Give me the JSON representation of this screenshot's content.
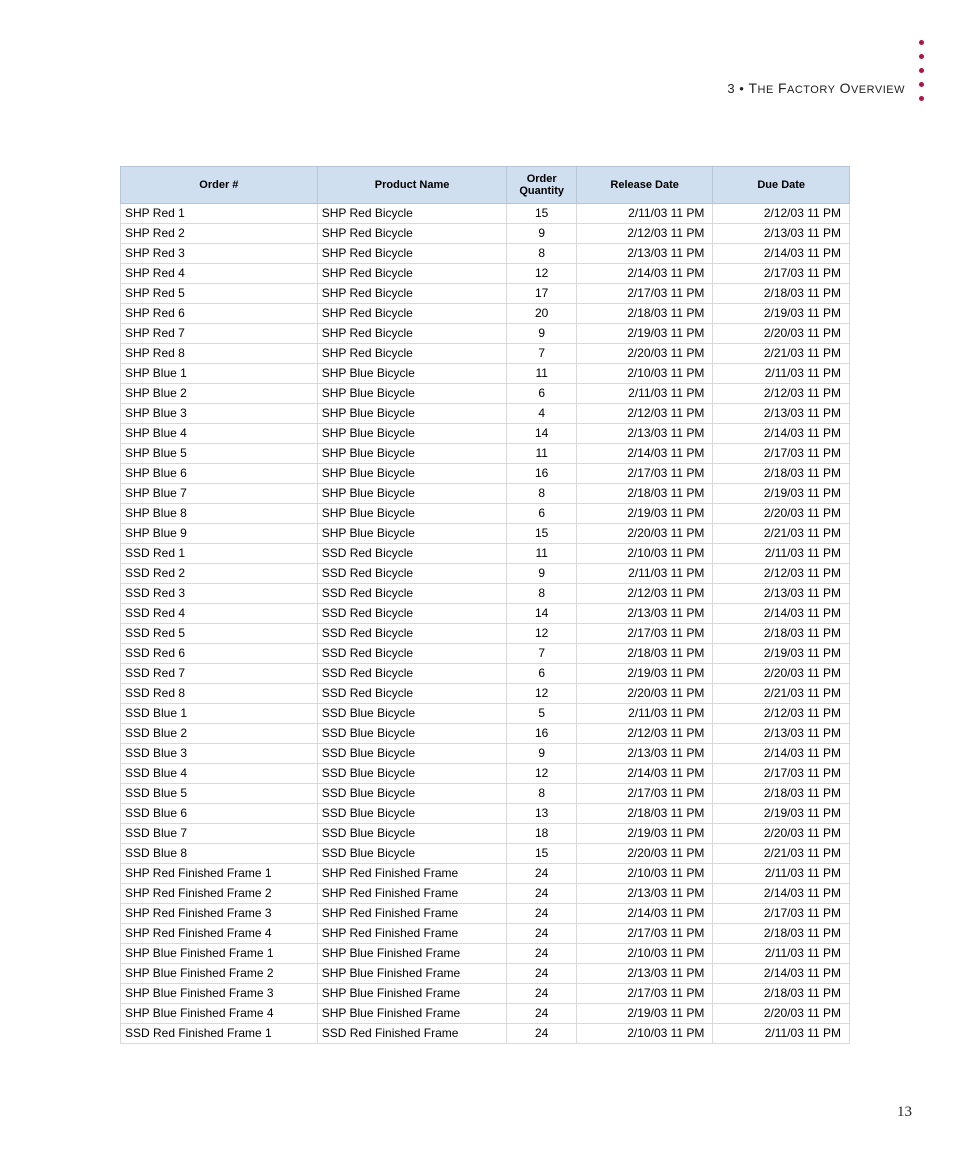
{
  "header": {
    "chapter_num": "3",
    "separator": "•",
    "title_smallcap_prefix": "T",
    "title_rest1": "HE",
    "title_word2_prefix": "F",
    "title_rest2": "ACTORY",
    "title_word3_prefix": "O",
    "title_rest3": "VERVIEW"
  },
  "page_number": "13",
  "table": {
    "columns": [
      "Order #",
      "Product Name",
      "Order Quantity",
      "Release Date",
      "Due Date"
    ],
    "ampm": "PM",
    "rows": [
      {
        "order": "SHP Red 1",
        "product": "SHP Red Bicycle",
        "qty": "15",
        "rel": "2/11/03 11",
        "due": "2/12/03 11"
      },
      {
        "order": "SHP Red 2",
        "product": "SHP Red Bicycle",
        "qty": "9",
        "rel": "2/12/03 11",
        "due": "2/13/03 11"
      },
      {
        "order": "SHP Red 3",
        "product": "SHP Red Bicycle",
        "qty": "8",
        "rel": "2/13/03 11",
        "due": "2/14/03 11"
      },
      {
        "order": "SHP Red 4",
        "product": "SHP Red Bicycle",
        "qty": "12",
        "rel": "2/14/03 11",
        "due": "2/17/03 11"
      },
      {
        "order": "SHP Red 5",
        "product": "SHP Red Bicycle",
        "qty": "17",
        "rel": "2/17/03 11",
        "due": "2/18/03 11"
      },
      {
        "order": "SHP Red 6",
        "product": "SHP Red Bicycle",
        "qty": "20",
        "rel": "2/18/03 11",
        "due": "2/19/03 11"
      },
      {
        "order": "SHP Red 7",
        "product": "SHP Red Bicycle",
        "qty": "9",
        "rel": "2/19/03 11",
        "due": "2/20/03 11"
      },
      {
        "order": "SHP Red 8",
        "product": "SHP Red Bicycle",
        "qty": "7",
        "rel": "2/20/03 11",
        "due": "2/21/03 11"
      },
      {
        "order": "SHP Blue 1",
        "product": "SHP Blue Bicycle",
        "qty": "11",
        "rel": "2/10/03 11",
        "due": "2/11/03 11"
      },
      {
        "order": "SHP Blue 2",
        "product": "SHP Blue Bicycle",
        "qty": "6",
        "rel": "2/11/03 11",
        "due": "2/12/03 11"
      },
      {
        "order": "SHP Blue 3",
        "product": "SHP Blue Bicycle",
        "qty": "4",
        "rel": "2/12/03 11",
        "due": "2/13/03 11"
      },
      {
        "order": "SHP Blue 4",
        "product": "SHP Blue Bicycle",
        "qty": "14",
        "rel": "2/13/03 11",
        "due": "2/14/03 11"
      },
      {
        "order": "SHP Blue 5",
        "product": "SHP Blue Bicycle",
        "qty": "11",
        "rel": "2/14/03 11",
        "due": "2/17/03 11"
      },
      {
        "order": "SHP Blue 6",
        "product": "SHP Blue Bicycle",
        "qty": "16",
        "rel": "2/17/03 11",
        "due": "2/18/03 11"
      },
      {
        "order": "SHP Blue 7",
        "product": "SHP Blue Bicycle",
        "qty": "8",
        "rel": "2/18/03 11",
        "due": "2/19/03 11"
      },
      {
        "order": "SHP Blue 8",
        "product": "SHP Blue Bicycle",
        "qty": "6",
        "rel": "2/19/03 11",
        "due": "2/20/03 11"
      },
      {
        "order": "SHP Blue 9",
        "product": "SHP Blue Bicycle",
        "qty": "15",
        "rel": "2/20/03 11",
        "due": "2/21/03 11"
      },
      {
        "order": "SSD Red 1",
        "product": "SSD Red Bicycle",
        "qty": "11",
        "rel": "2/10/03 11",
        "due": "2/11/03 11"
      },
      {
        "order": "SSD Red 2",
        "product": "SSD Red Bicycle",
        "qty": "9",
        "rel": "2/11/03 11",
        "due": "2/12/03 11"
      },
      {
        "order": "SSD Red 3",
        "product": "SSD Red Bicycle",
        "qty": "8",
        "rel": "2/12/03 11",
        "due": "2/13/03 11"
      },
      {
        "order": "SSD Red 4",
        "product": "SSD Red Bicycle",
        "qty": "14",
        "rel": "2/13/03 11",
        "due": "2/14/03 11"
      },
      {
        "order": "SSD Red 5",
        "product": "SSD Red Bicycle",
        "qty": "12",
        "rel": "2/17/03 11",
        "due": "2/18/03 11"
      },
      {
        "order": "SSD Red 6",
        "product": "SSD Red Bicycle",
        "qty": "7",
        "rel": "2/18/03 11",
        "due": "2/19/03 11"
      },
      {
        "order": "SSD Red 7",
        "product": "SSD Red Bicycle",
        "qty": "6",
        "rel": "2/19/03 11",
        "due": "2/20/03 11"
      },
      {
        "order": "SSD Red 8",
        "product": "SSD Red Bicycle",
        "qty": "12",
        "rel": "2/20/03 11",
        "due": "2/21/03 11"
      },
      {
        "order": "SSD Blue 1",
        "product": "SSD Blue Bicycle",
        "qty": "5",
        "rel": "2/11/03 11",
        "due": "2/12/03 11"
      },
      {
        "order": "SSD Blue 2",
        "product": "SSD Blue Bicycle",
        "qty": "16",
        "rel": "2/12/03 11",
        "due": "2/13/03 11"
      },
      {
        "order": "SSD Blue 3",
        "product": "SSD Blue Bicycle",
        "qty": "9",
        "rel": "2/13/03 11",
        "due": "2/14/03 11"
      },
      {
        "order": "SSD Blue 4",
        "product": "SSD Blue Bicycle",
        "qty": "12",
        "rel": "2/14/03 11",
        "due": "2/17/03 11"
      },
      {
        "order": "SSD Blue 5",
        "product": "SSD Blue Bicycle",
        "qty": "8",
        "rel": "2/17/03 11",
        "due": "2/18/03 11"
      },
      {
        "order": "SSD Blue 6",
        "product": "SSD Blue Bicycle",
        "qty": "13",
        "rel": "2/18/03 11",
        "due": "2/19/03 11"
      },
      {
        "order": "SSD Blue 7",
        "product": "SSD Blue Bicycle",
        "qty": "18",
        "rel": "2/19/03 11",
        "due": "2/20/03 11"
      },
      {
        "order": "SSD Blue 8",
        "product": "SSD Blue Bicycle",
        "qty": "15",
        "rel": "2/20/03 11",
        "due": "2/21/03 11"
      },
      {
        "order": "SHP Red Finished Frame 1",
        "product": "SHP Red Finished Frame",
        "qty": "24",
        "rel": "2/10/03 11",
        "due": "2/11/03 11"
      },
      {
        "order": "SHP Red Finished Frame 2",
        "product": "SHP Red Finished Frame",
        "qty": "24",
        "rel": "2/13/03 11",
        "due": "2/14/03 11"
      },
      {
        "order": "SHP Red Finished Frame 3",
        "product": "SHP Red Finished Frame",
        "qty": "24",
        "rel": "2/14/03 11",
        "due": "2/17/03 11"
      },
      {
        "order": "SHP Red Finished Frame 4",
        "product": "SHP Red Finished Frame",
        "qty": "24",
        "rel": "2/17/03 11",
        "due": "2/18/03 11"
      },
      {
        "order": "SHP Blue Finished Frame 1",
        "product": "SHP Blue Finished Frame",
        "qty": "24",
        "rel": "2/10/03 11",
        "due": "2/11/03 11"
      },
      {
        "order": "SHP Blue Finished Frame 2",
        "product": "SHP Blue Finished Frame",
        "qty": "24",
        "rel": "2/13/03 11",
        "due": "2/14/03 11"
      },
      {
        "order": "SHP Blue Finished Frame 3",
        "product": "SHP Blue Finished Frame",
        "qty": "24",
        "rel": "2/17/03 11",
        "due": "2/18/03 11"
      },
      {
        "order": "SHP Blue Finished Frame 4",
        "product": "SHP Blue Finished Frame",
        "qty": "24",
        "rel": "2/19/03 11",
        "due": "2/20/03 11"
      },
      {
        "order": "SSD Red Finished Frame 1",
        "product": "SSD Red Finished Frame",
        "qty": "24",
        "rel": "2/10/03 11",
        "due": "2/11/03 11"
      }
    ]
  }
}
